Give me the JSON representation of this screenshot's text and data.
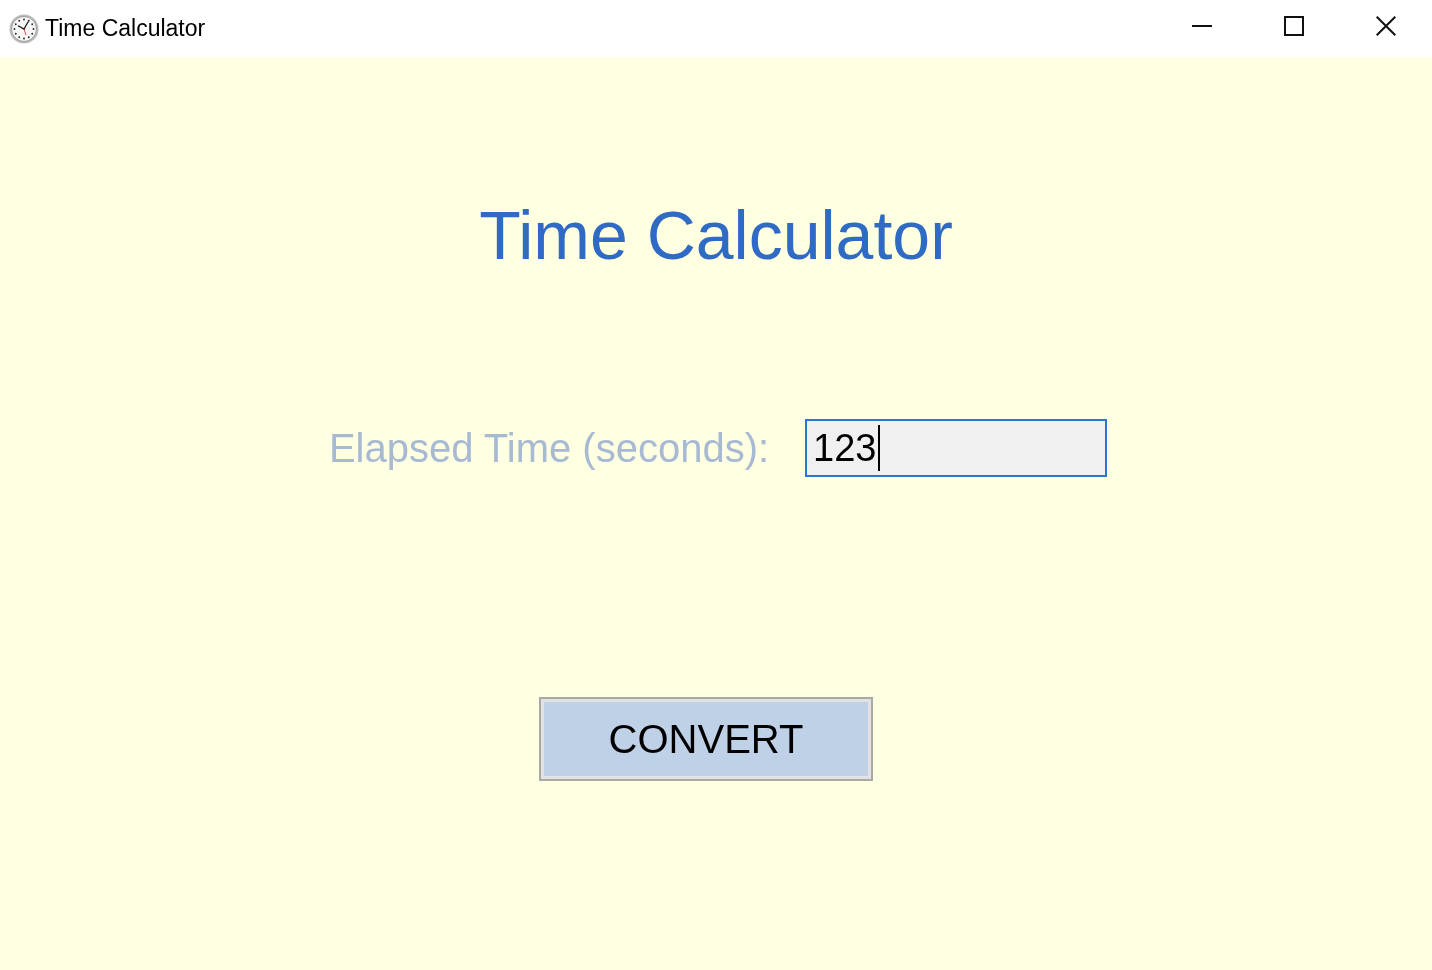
{
  "window": {
    "title": "Time Calculator"
  },
  "heading": "Time Calculator",
  "form": {
    "label": "Elapsed Time (seconds):",
    "field": {
      "value": "123",
      "focused": true
    }
  },
  "convert_button": {
    "label": "CONVERT"
  }
}
